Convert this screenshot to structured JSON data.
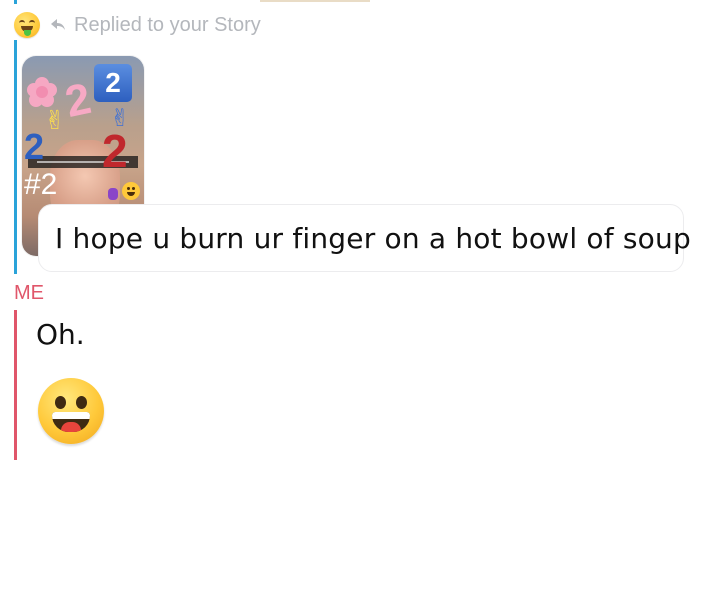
{
  "conversation": {
    "reply_header": {
      "label": "Replied to your Story",
      "reactor_emoji_icon": "money-mouth-face-icon",
      "reply_arrow_icon": "reply-arrow-icon"
    },
    "story_thumbnail": {
      "stickers": {
        "number_block": "2",
        "pink_two": "2",
        "red_two": "2",
        "hashtag": "#2",
        "blue_two": "2"
      }
    },
    "incoming_message": "I hope u burn ur finger on a hot bowl of soup",
    "outgoing": {
      "sender_label": "ME",
      "message": "Oh.",
      "emoji_icon": "grinning-face-icon"
    }
  },
  "colors": {
    "friend_accent": "#2aa3d9",
    "me_accent": "#e0566a",
    "muted_text": "#b4b7bc",
    "text": "#111111"
  }
}
